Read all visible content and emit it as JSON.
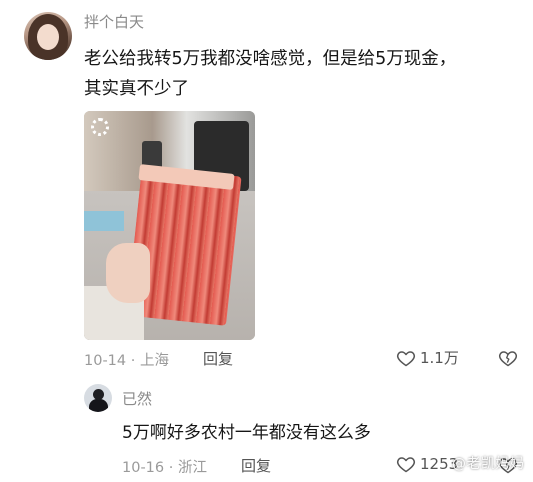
{
  "main_comment": {
    "username": "拌个白天",
    "text_line1": "老公给我转5万我都没啥感觉，但是给5万现金，",
    "text_line2": "其实真不少了",
    "date_location": "10-14 · 上海",
    "reply_label": "回复",
    "like_count": "1.1万"
  },
  "reply_comment": {
    "username": "已然",
    "text": "5万啊好多农村一年都没有这么多",
    "date_location": "10-16 · 浙江",
    "reply_label": "回复",
    "like_count": "1253"
  },
  "watermark": "@老凯妈妈",
  "icons": {
    "like": "heart-outline-icon",
    "dislike": "broken-heart-icon",
    "photo_badge": "settings-icon"
  },
  "colors": {
    "text_primary": "#161616",
    "text_secondary": "#9a9a9a",
    "username": "#8a8a8a"
  }
}
